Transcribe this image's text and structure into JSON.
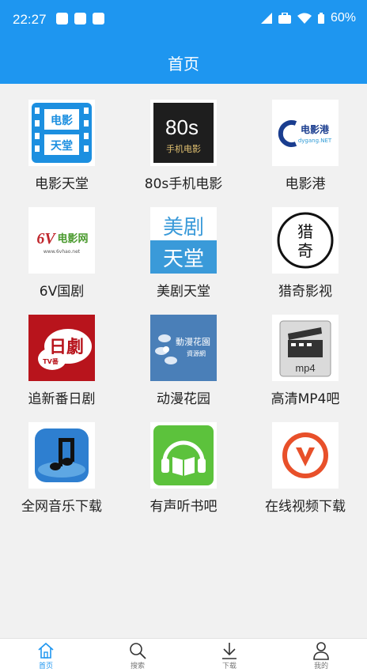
{
  "status_bar": {
    "time": "22:27",
    "battery": "60%"
  },
  "header": {
    "title": "首页"
  },
  "apps": [
    {
      "label": "电影天堂",
      "icon": "dytt-logo-icon"
    },
    {
      "label": "80s手机电影",
      "icon": "80s-logo-icon"
    },
    {
      "label": "电影港",
      "icon": "dyg-logo-icon"
    },
    {
      "label": "6V国剧",
      "icon": "6v-logo-icon"
    },
    {
      "label": "美剧天堂",
      "icon": "mjtt-logo-icon"
    },
    {
      "label": "猎奇影视",
      "icon": "lieqi-logo-icon"
    },
    {
      "label": "追新番日剧",
      "icon": "zxf-logo-icon"
    },
    {
      "label": "动漫花园",
      "icon": "dmhy-logo-icon"
    },
    {
      "label": "高清MP4吧",
      "icon": "mp4-logo-icon"
    },
    {
      "label": "全网音乐下载",
      "icon": "music-logo-icon"
    },
    {
      "label": "有声听书吧",
      "icon": "audiobook-logo-icon"
    },
    {
      "label": "在线视频下载",
      "icon": "video-download-logo-icon"
    }
  ],
  "logo_text": {
    "dytt_top": "电影",
    "dytt_bottom": "天堂",
    "s80_big": "80s",
    "s80_small": "手机电影",
    "dyg_main": "电影港",
    "dyg_url": "dygang.NET",
    "v6_main": "6V",
    "v6_cn": "电影网",
    "v6_url": "www.6vhao.net",
    "mjtt_top": "美剧",
    "mjtt_bottom": "天堂",
    "lq_top": "猎",
    "lq_bottom": "奇",
    "zxf_main": "日劇",
    "zxf_tv": "TV番",
    "dmhy_main": "動漫花園",
    "dmhy_sub": "資源網",
    "mp4_label": "mp4"
  },
  "tabs": [
    {
      "label": "首页",
      "icon": "home-icon"
    },
    {
      "label": "搜索",
      "icon": "search-icon"
    },
    {
      "label": "下载",
      "icon": "download-icon"
    },
    {
      "label": "我的",
      "icon": "user-icon"
    }
  ],
  "colors": {
    "primary": "#1e96f0",
    "background": "#f1f1f1"
  }
}
